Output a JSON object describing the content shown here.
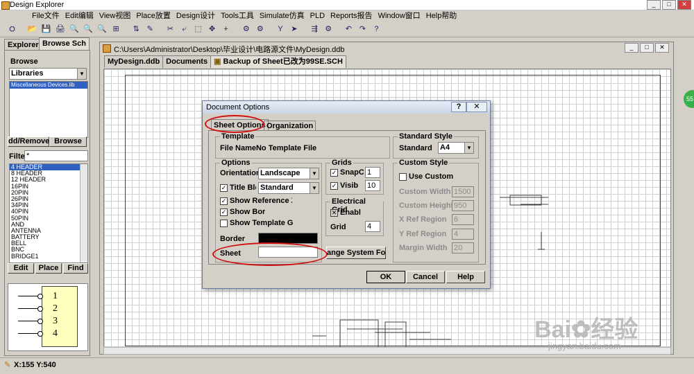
{
  "app": {
    "title": "Design Explorer"
  },
  "window_buttons": {
    "min": "_",
    "max": "□",
    "close": "✕"
  },
  "menu": [
    "File文件",
    "Edit编辑",
    "View视图",
    "Place放置",
    "Design设计",
    "Tools工具",
    "Simulate仿真",
    "PLD",
    "Reports报告",
    "Window窗口",
    "Help帮助"
  ],
  "toolbar_icons": [
    "⛭",
    "📂",
    "💾",
    "🖨",
    "🔍",
    "🔍",
    "🔍",
    "⊞",
    "⇅",
    "✎",
    "✂",
    "⤶",
    "⬚",
    "✥",
    "+",
    "⚙",
    "⚙",
    "Y",
    "➤",
    "⇶",
    "⚙",
    "↶",
    "↷",
    "?"
  ],
  "left_panel": {
    "tabs": [
      "Explorer",
      "Browse Sch"
    ],
    "browse_label": "Browse",
    "browse_combo": "Libraries",
    "library_item": "Miscellaneous Devices.lib",
    "add_remove": "dd/Remove",
    "browse_btn": "Browse",
    "filter_label": "Filte",
    "filter_value": "*",
    "components": [
      "4 HEADER",
      "8 HEADER",
      "12 HEADER",
      "16PIN",
      "20PIN",
      "26PIN",
      "34PIN",
      "40PIN",
      "50PIN",
      "AND",
      "ANTENNA",
      "BATTERY",
      "BELL",
      "BNC",
      "BRIDGE1"
    ],
    "edit_btn": "Edit",
    "place_btn": "Place",
    "find_btn": "Find",
    "preview_pins": [
      "1",
      "2",
      "3",
      "4"
    ]
  },
  "document": {
    "path": "C:\\Users\\Administrator\\Desktop\\毕业设计\\电路源文件\\MyDesign.ddb",
    "tabs": [
      "MyDesign.ddb",
      "Documents",
      "Backup of Sheet已改为99SE.SCH"
    ]
  },
  "dialog": {
    "title": "Document Options",
    "help_q": "?",
    "close": "✕",
    "tabs": [
      "Sheet Options",
      "Organization"
    ],
    "template": {
      "label": "Template",
      "file_label": "File Name",
      "file_value": "No Template File"
    },
    "options": {
      "label": "Options",
      "orientation_label": "Orientation",
      "orientation_value": "Landscape",
      "title_block_label": "Title Blc",
      "title_block_value": "Standard",
      "show_ref": "Show Reference Z",
      "show_border": "Show Bor",
      "show_template": "Show Template Gra",
      "border_label": "Border",
      "sheet_label": "Sheet"
    },
    "grids": {
      "label": "Grids",
      "snap_label": "SnapC",
      "snap_value": "1",
      "visible_label": "Visib",
      "visible_value": "10"
    },
    "electrical": {
      "label": "Electrical Grid",
      "enable_label": "Enabl",
      "grid_label": "Grid",
      "grid_value": "4"
    },
    "change_font_btn": "ange System Fo",
    "standard": {
      "label": "Standard Style",
      "standard_label": "Standard",
      "standard_value": "A4"
    },
    "custom": {
      "label": "Custom Style",
      "use_custom": "Use Custom",
      "width_label": "Custom Width",
      "width_value": "1500",
      "height_label": "Custom Height",
      "height_value": "950",
      "xref_label": "X Ref Region",
      "xref_value": "6",
      "yref_label": "Y Ref Region",
      "yref_value": "4",
      "margin_label": "Margin Width",
      "margin_value": "20"
    },
    "ok": "OK",
    "cancel": "Cancel",
    "help": "Help",
    "colors": {
      "border_color": "#000000",
      "sheet_color": "#ffffff"
    }
  },
  "status": {
    "coords": "X:155 Y:540"
  },
  "watermark": {
    "brand": "Bai",
    "brand2": "经验",
    "url": "jingyan.baidu.com"
  },
  "side_badge": "55"
}
